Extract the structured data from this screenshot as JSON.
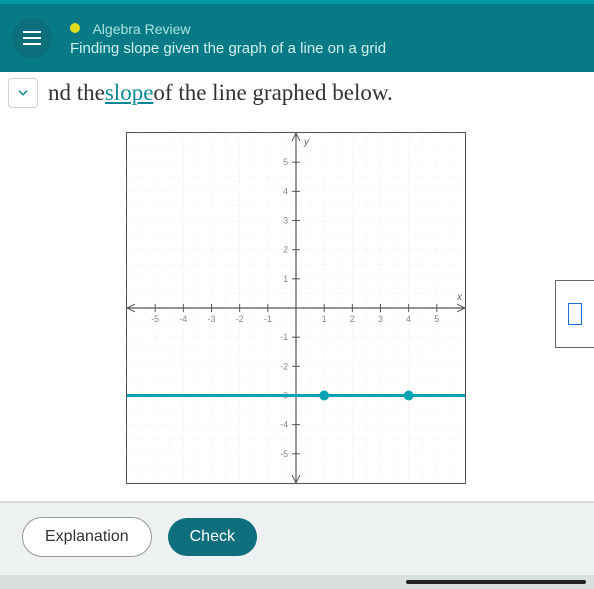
{
  "header": {
    "title": "Algebra Review",
    "subtitle": "Finding slope given the graph of a line on a grid"
  },
  "question": {
    "pre": "nd the ",
    "link": "slope",
    "post": " of the line graphed below."
  },
  "buttons": {
    "explanation": "Explanation",
    "check": "Check"
  },
  "chart_data": {
    "type": "line",
    "title": "",
    "xlabel": "x",
    "ylabel": "y",
    "xlim": [
      -6,
      6
    ],
    "ylim": [
      -6,
      6
    ],
    "xticks": [
      -5,
      -4,
      -3,
      -2,
      -1,
      1,
      2,
      3,
      4,
      5
    ],
    "yticks": [
      -5,
      -4,
      -3,
      -2,
      -1,
      1,
      2,
      3,
      4,
      5
    ],
    "series": [
      {
        "name": "line",
        "x": [
          -6,
          6
        ],
        "y": [
          -3,
          -3
        ]
      }
    ],
    "points": [
      {
        "x": 1,
        "y": -3
      },
      {
        "x": 4,
        "y": -3
      }
    ]
  }
}
